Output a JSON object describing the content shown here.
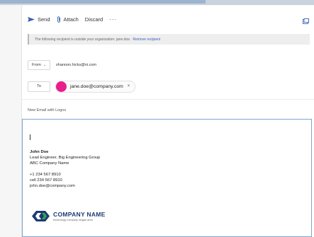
{
  "toolbar": {
    "send_label": "Send",
    "attach_label": "Attach",
    "discard_label": "Discard",
    "more_label": "···"
  },
  "infobar": {
    "message": "The following recipient is outside your organization: jane.doe.",
    "action_label": "Remove recipient"
  },
  "from": {
    "label": "From",
    "address": "shannon.hicks@ni.com"
  },
  "to": {
    "label": "To",
    "recipient": "jane.doe@company.com",
    "remove_label": "×"
  },
  "subject": "New Email with Logos",
  "signature": {
    "name": "John Doe",
    "title": "Lead Engineer, Big Engineering Group",
    "company": "ABC Company Name",
    "phone": "+1 234 567 8910",
    "cell": "cell 234 567 8910",
    "email": "john.doe@company.com"
  },
  "logo": {
    "name": "COMPANY NAME",
    "tagline": "technology company slogan area",
    "color": "#1d3a73",
    "accent_color": "#2fa84f"
  },
  "colors": {
    "avatar": "#e91e8c",
    "link": "#3a62b8",
    "focus_border": "#7fa3cf"
  }
}
